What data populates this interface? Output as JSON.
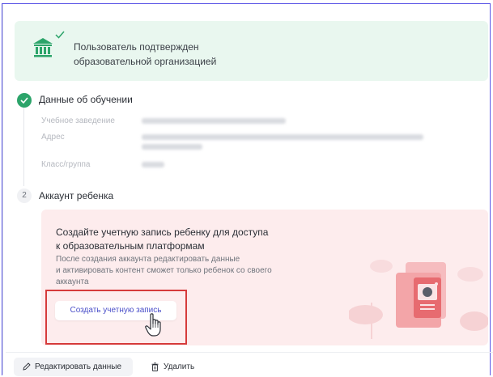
{
  "verified_banner": {
    "line1": "Пользователь подтвержден",
    "line2": "образовательной организацией",
    "icon": "bank-icon"
  },
  "steps": [
    {
      "number": "1",
      "status": "done",
      "title": "Данные об обучении",
      "fields": [
        {
          "label": "Учебное заведение"
        },
        {
          "label": "Адрес"
        },
        {
          "label": "Класс/группа"
        }
      ]
    },
    {
      "number": "2",
      "status": "pending",
      "title": "Аккаунт ребенка"
    }
  ],
  "child_panel": {
    "title_line1": "Создайте учетную запись ребенку для доступа",
    "title_line2": "к образовательным платформам",
    "desc_line1": "После создания аккаунта редактировать данные",
    "desc_line2": "и активировать контент сможет только ребенок со своего",
    "desc_line3": "аккаунта",
    "create_button": "Создать учетную запись"
  },
  "footer": {
    "edit_button": "Редактировать данные",
    "delete_button": "Удалить"
  },
  "colors": {
    "accent": "#5b56e6",
    "success": "#2ca46a",
    "banner_bg": "#e9f7ef",
    "panel_bg": "#fdeced",
    "highlight": "#d63b3b",
    "link": "#4a4fc9"
  }
}
